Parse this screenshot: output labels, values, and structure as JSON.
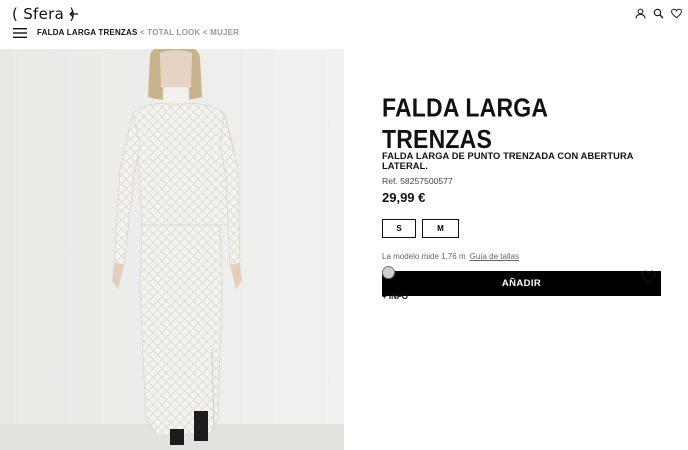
{
  "header": {
    "logo": "Sfera",
    "breadcrumb": {
      "current": "FALDA LARGA TRENZAS",
      "items": [
        "TOTAL LOOK",
        "MUJER"
      ],
      "separator": "<"
    }
  },
  "product": {
    "title": "FALDA LARGA TRENZAS",
    "description": "FALDA LARGA DE PUNTO TRENZADA CON ABERTURA LATERAL.",
    "ref": "Ref. 58257500577",
    "price": "29,99 €",
    "sizes": [
      "S",
      "M"
    ],
    "model_note": "La modelo mide 1,76 m",
    "size_guide": "Guía de tallas",
    "add_button": "AÑADIR",
    "colors": [
      "#cfcfcf"
    ],
    "more_info": "+ INFO"
  },
  "icons": {
    "back": "arrow-left-icon",
    "account": "user-icon",
    "search": "search-icon",
    "wishlist": "heart-icon",
    "menu": "hamburger-menu-icon"
  }
}
